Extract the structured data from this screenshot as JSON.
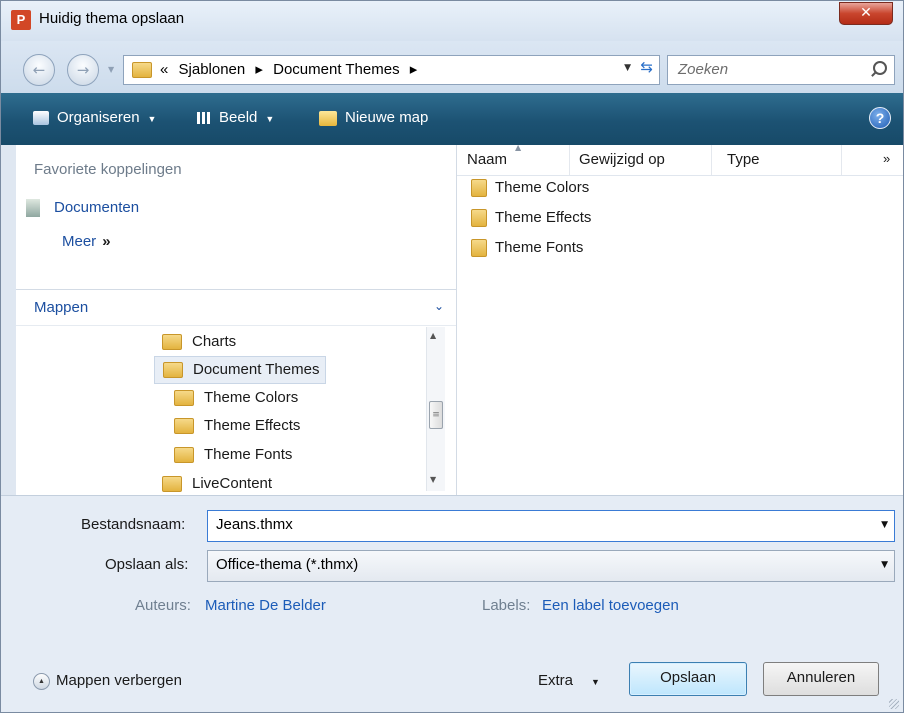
{
  "window": {
    "title": "Huidig thema opslaan",
    "app_icon_letter": "P",
    "close_glyph": "✕"
  },
  "address": {
    "overflow": "«",
    "crumbs": [
      "Sjablonen",
      "Document Themes"
    ],
    "separator": "▸",
    "search_placeholder": "Zoeken"
  },
  "toolbar": {
    "organize_label": "Organiseren",
    "view_label": "Beeld",
    "new_folder_label": "Nieuwe map",
    "help_glyph": "?"
  },
  "nav_pane": {
    "favorites_title": "Favoriete koppelingen",
    "favorites": [
      "Documenten"
    ],
    "more_label": "Meer",
    "more_glyph": "»",
    "folders_title": "Mappen",
    "tree": [
      {
        "label": "Charts",
        "level": 0
      },
      {
        "label": "Document Themes",
        "level": 0,
        "selected": true
      },
      {
        "label": "Theme Colors",
        "level": 1
      },
      {
        "label": "Theme Effects",
        "level": 1
      },
      {
        "label": "Theme Fonts",
        "level": 1
      },
      {
        "label": "LiveContent",
        "level": 0
      }
    ]
  },
  "file_list": {
    "columns": [
      "Naam",
      "Gewijzigd op",
      "Type"
    ],
    "more_columns_glyph": "»",
    "items": [
      "Theme Colors",
      "Theme Effects",
      "Theme Fonts"
    ]
  },
  "save_form": {
    "filename_label": "Bestandsnaam:",
    "filename_value": "Jeans.thmx",
    "filetype_label": "Opslaan als:",
    "filetype_value": "Office-thema (*.thmx)",
    "authors_label": "Auteurs:",
    "authors_value": "Martine De Belder",
    "tags_label": "Labels:",
    "tags_value": "Een label toevoegen"
  },
  "footer": {
    "hide_folders_label": "Mappen verbergen",
    "tools_label": "Extra",
    "save_label": "Opslaan",
    "cancel_label": "Annuleren"
  },
  "colors": {
    "toolbar": "#1c5273",
    "link": "#1c4fa0",
    "close_button": "#c9452d"
  }
}
